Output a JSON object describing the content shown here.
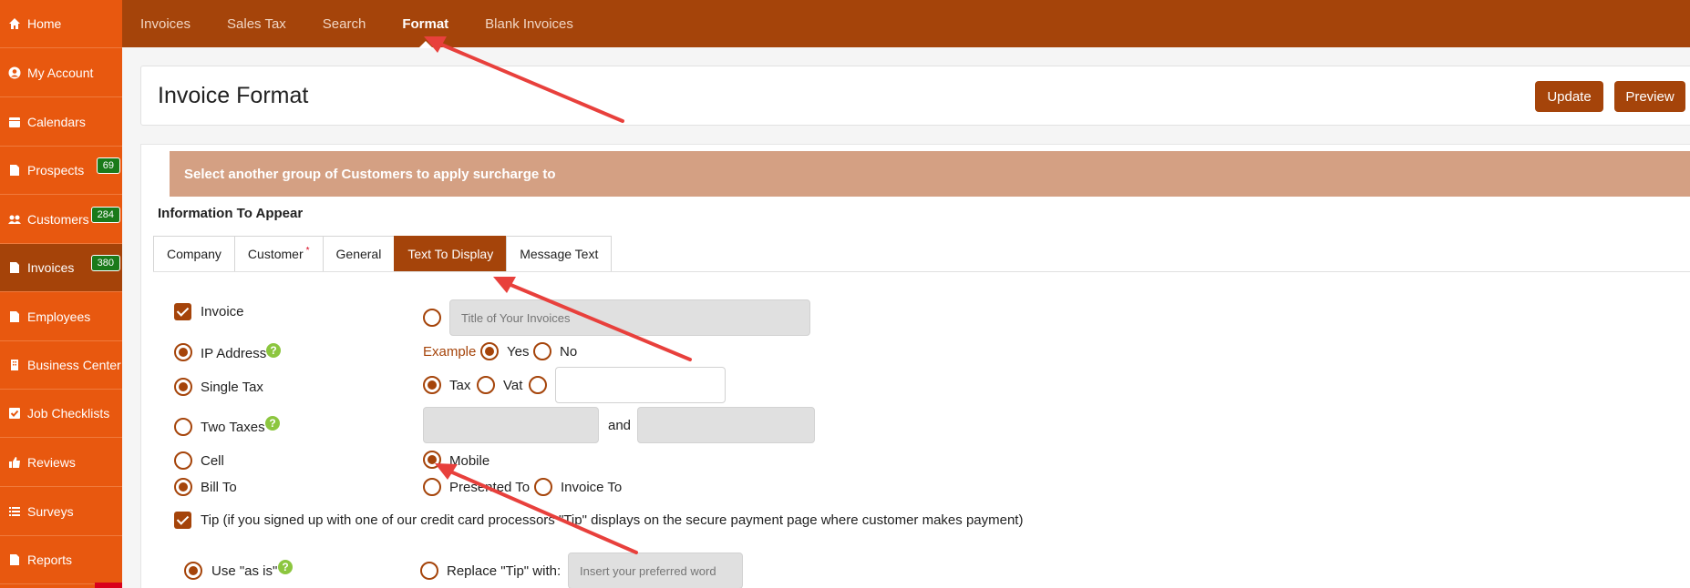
{
  "sidebar": {
    "items": [
      {
        "label": "Home",
        "icon": "home-icon"
      },
      {
        "label": "My Account",
        "icon": "user-circle-icon"
      },
      {
        "label": "Calendars",
        "icon": "calendar-icon"
      },
      {
        "label": "Prospects",
        "icon": "document-icon",
        "badge": "69"
      },
      {
        "label": "Customers",
        "icon": "users-icon",
        "badge": "284"
      },
      {
        "label": "Invoices",
        "icon": "document-icon",
        "badge": "380"
      },
      {
        "label": "Employees",
        "icon": "document-icon"
      },
      {
        "label": "Business Center",
        "icon": "building-icon"
      },
      {
        "label": "Job Checklists",
        "icon": "checklist-icon"
      },
      {
        "label": "Reviews",
        "icon": "thumbs-up-icon"
      },
      {
        "label": "Surveys",
        "icon": "list-icon"
      },
      {
        "label": "Reports",
        "icon": "document-icon"
      }
    ]
  },
  "topnav": {
    "items": [
      "Invoices",
      "Sales Tax",
      "Search",
      "Format",
      "Blank Invoices"
    ],
    "active": "Format"
  },
  "header": {
    "title": "Invoice Format",
    "update_label": "Update",
    "preview_label": "Preview"
  },
  "banner": "Select another group of Customers to apply surcharge to",
  "section_title": "Information To Appear",
  "tabs": {
    "items": [
      "Company",
      "Customer",
      "General",
      "Text To Display",
      "Message Text"
    ],
    "active": "Text To Display",
    "required_mark": "*"
  },
  "form": {
    "invoice_label": "Invoice",
    "invoice_title_placeholder": "Title of Your Invoices",
    "ip_address_label": "IP Address",
    "example_label": "Example",
    "yes_label": "Yes",
    "no_label": "No",
    "single_tax_label": "Single Tax",
    "tax_label": "Tax",
    "vat_label": "Vat",
    "two_taxes_label": "Two Taxes",
    "and_label": "and",
    "cell_label": "Cell",
    "mobile_label": "Mobile",
    "bill_to_label": "Bill To",
    "presented_to_label": "Presented To",
    "invoice_to_label": "Invoice To",
    "tip_label": "Tip (if you signed up with one of our credit card processors \"Tip\" displays on the secure payment page where customer makes payment)",
    "use_as_is_label": "Use \"as is\"",
    "replace_tip_label": "Replace \"Tip\" with:",
    "replace_tip_placeholder": "Insert your preferred word",
    "help_glyph": "?"
  },
  "colors": {
    "sidebar": "#e8580f",
    "accent": "#a5440a",
    "badge": "#1a7a1a",
    "banner": "#d4a083",
    "help": "#8cc63f",
    "annotation_arrow": "#e8403c"
  }
}
